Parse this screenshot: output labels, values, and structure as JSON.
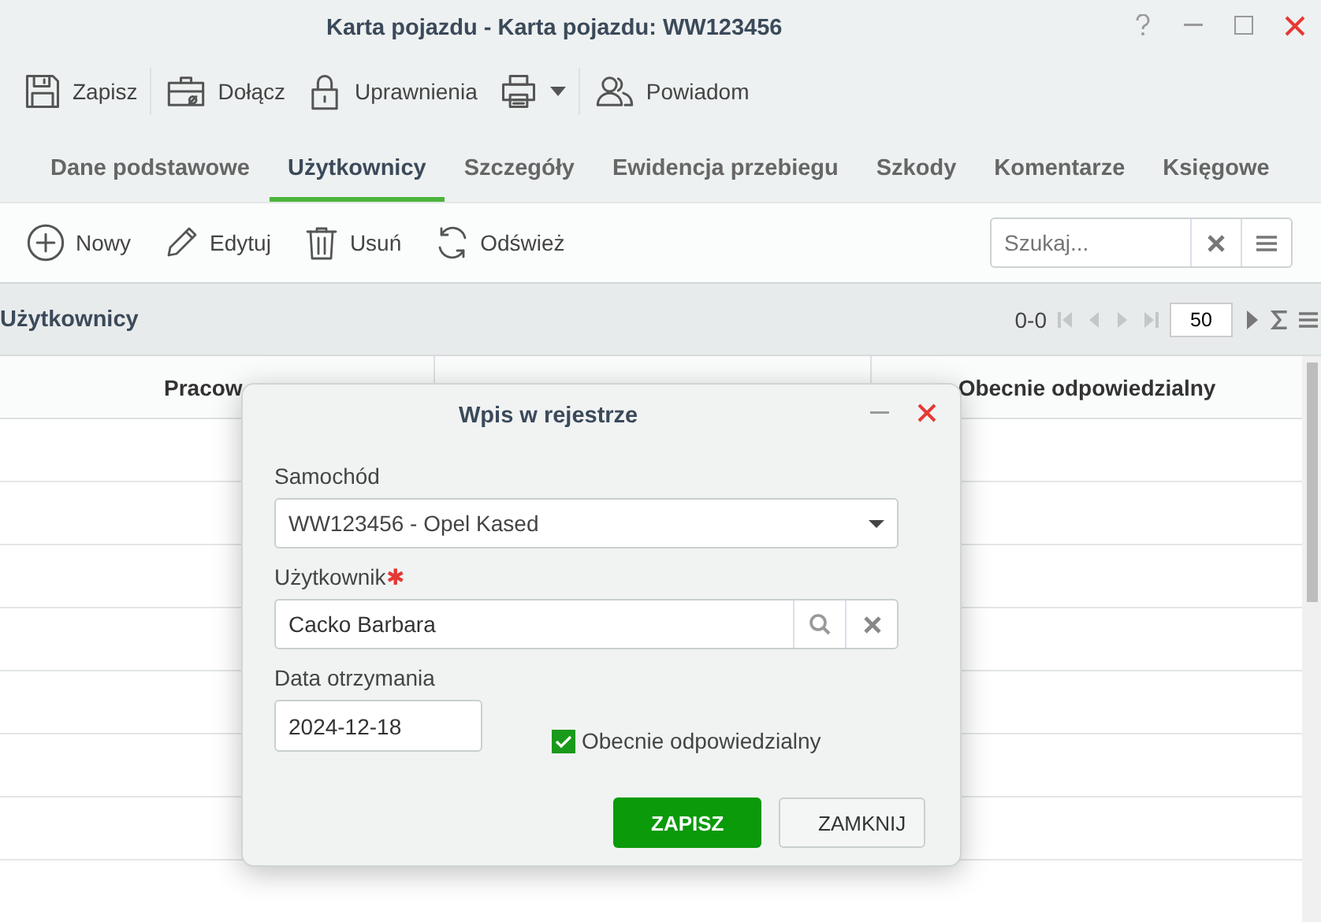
{
  "window": {
    "title": "Karta pojazdu - Karta pojazdu: WW123456"
  },
  "toolbar": [
    {
      "kind": "save",
      "label": "Zapisz"
    },
    {
      "kind": "attach",
      "label": "Dołącz"
    },
    {
      "kind": "lock",
      "label": "Uprawnienia"
    },
    {
      "kind": "print"
    },
    {
      "kind": "people",
      "label": "Powiadom"
    }
  ],
  "tabs": [
    {
      "label": "Dane podstawowe",
      "selected": false
    },
    {
      "label": "Użytkownicy",
      "selected": true
    },
    {
      "label": "Szczegóły",
      "selected": false
    },
    {
      "label": "Ewidencja przebiegu",
      "selected": false
    },
    {
      "label": "Szkody",
      "selected": false
    },
    {
      "label": "Komentarze",
      "selected": false
    },
    {
      "label": "Księgowe",
      "selected": false
    }
  ],
  "actions": [
    {
      "kind": "add",
      "label": "Nowy"
    },
    {
      "kind": "edit",
      "label": "Edytuj"
    },
    {
      "kind": "delete",
      "label": "Usuń"
    },
    {
      "kind": "refresh",
      "label": "Odśwież"
    }
  ],
  "search": {
    "placeholder": "Szukaj..."
  },
  "grid": {
    "title": "Użytkownicy",
    "range": "0-0",
    "page_size": "50",
    "column_1": "Pracow",
    "column_3": "Obecnie odpowiedzialny"
  },
  "dialog": {
    "title": "Wpis w rejestrze",
    "car": {
      "label": "Samochód",
      "value": "WW123456 - Opel Kased"
    },
    "user": {
      "label": "Użytkownik",
      "required_mark": "✱",
      "value": "Cacko Barbara"
    },
    "date": {
      "label": "Data otrzymania",
      "value": "2024-12-18"
    },
    "responsible": {
      "label": "Obecnie odpowiedzialny",
      "checked": true
    },
    "buttons": [
      {
        "label": "ZAPISZ",
        "kind": "primary"
      },
      {
        "label": "ZAMKNIJ",
        "kind": "secondary"
      }
    ]
  }
}
